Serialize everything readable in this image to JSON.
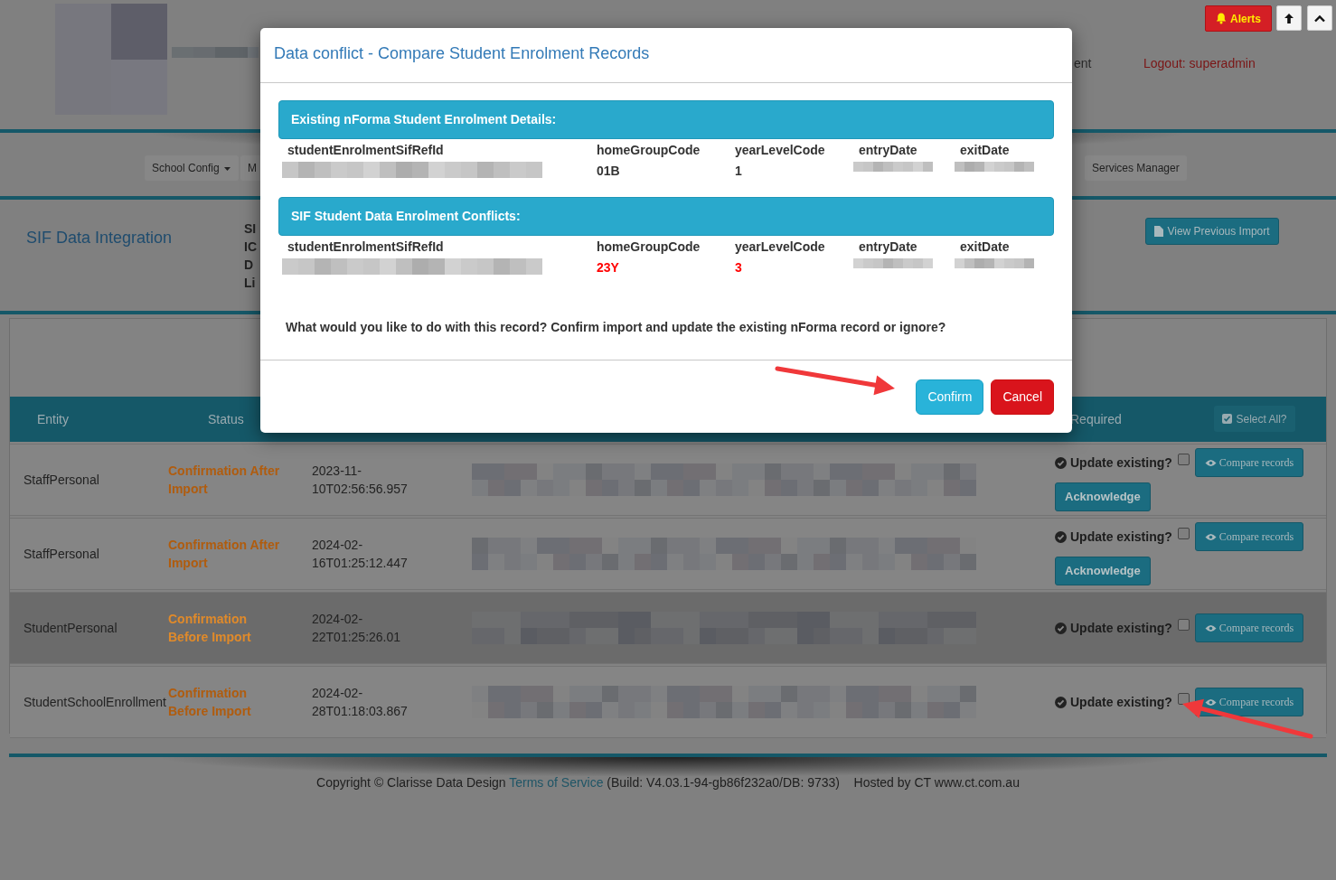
{
  "header": {
    "menu_fragment": "ent",
    "logout": "Logout: superadmin",
    "alerts": "Alerts"
  },
  "nav": [
    {
      "label": "School Config",
      "dropdown": true
    },
    {
      "label": "M",
      "dropdown": false
    },
    {
      "label": "Services Manager",
      "dropdown": false
    }
  ],
  "section": {
    "title": "SIF Data Integration",
    "info_lines": [
      "SI",
      "IC",
      "D",
      "Li"
    ],
    "view_button": "View Previous Import"
  },
  "table": {
    "columns": [
      "Entity",
      "Status",
      "Required"
    ],
    "select_all": "Select All?",
    "rows": [
      {
        "entity": "StaffPersonal",
        "status": "Confirmation After Import",
        "date": "2023-11-10T02:56:56.957",
        "update_label": "Update existing?",
        "checked": false,
        "compare": "Compare records",
        "acknowledge": "Acknowledge",
        "selected": false
      },
      {
        "entity": "StaffPersonal",
        "status": "Confirmation After Import",
        "date": "2024-02-16T01:25:12.447",
        "update_label": "Update existing?",
        "checked": false,
        "compare": "Compare records",
        "acknowledge": "Acknowledge",
        "selected": false
      },
      {
        "entity": "StudentPersonal",
        "status": "Confirmation Before Import",
        "date": "2024-02-22T01:25:26.01",
        "update_label": "Update existing?",
        "checked": false,
        "compare": "Compare records",
        "selected": true
      },
      {
        "entity": "StudentSchoolEnrollment",
        "status": "Confirmation Before Import",
        "date": "2024-02-28T01:18:03.867",
        "update_label": "Update existing?",
        "checked": false,
        "compare": "Compare records",
        "selected": false
      }
    ]
  },
  "footer": {
    "copyright": "Copyright © Clarisse Data Design",
    "terms_link": "Terms of Service",
    "build": "(Build: V4.03.1-94-gb86f232a0/DB: 9733)",
    "hosted": "Hosted by CT www.ct.com.au"
  },
  "modal": {
    "title": "Data conflict - Compare Student Enrolment Records",
    "sections": [
      {
        "heading": "Existing nForma Student Enrolment Details:",
        "fields": [
          {
            "label": "studentEnrolmentSifRefId",
            "redacted": true,
            "conflict": false
          },
          {
            "label": "homeGroupCode",
            "value": "01B",
            "redacted": false,
            "conflict": false
          },
          {
            "label": "yearLevelCode",
            "value": "1",
            "redacted": false,
            "conflict": false
          },
          {
            "label": "entryDate",
            "redacted": true,
            "conflict": false
          },
          {
            "label": "exitDate",
            "redacted": true,
            "conflict": false
          }
        ]
      },
      {
        "heading": "SIF Student Data Enrolment Conflicts:",
        "fields": [
          {
            "label": "studentEnrolmentSifRefId",
            "redacted": true,
            "conflict": false
          },
          {
            "label": "homeGroupCode",
            "value": "23Y",
            "redacted": false,
            "conflict": true
          },
          {
            "label": "yearLevelCode",
            "value": "3",
            "redacted": false,
            "conflict": true
          },
          {
            "label": "entryDate",
            "redacted": true,
            "conflict": false
          },
          {
            "label": "exitDate",
            "redacted": true,
            "conflict": false
          }
        ]
      }
    ],
    "question": "What would you like to do with this record? Confirm import and update the existing nForma record or ignore?",
    "buttons": [
      {
        "label": "Confirm",
        "kind": "primary"
      },
      {
        "label": "Cancel",
        "kind": "danger"
      }
    ]
  }
}
